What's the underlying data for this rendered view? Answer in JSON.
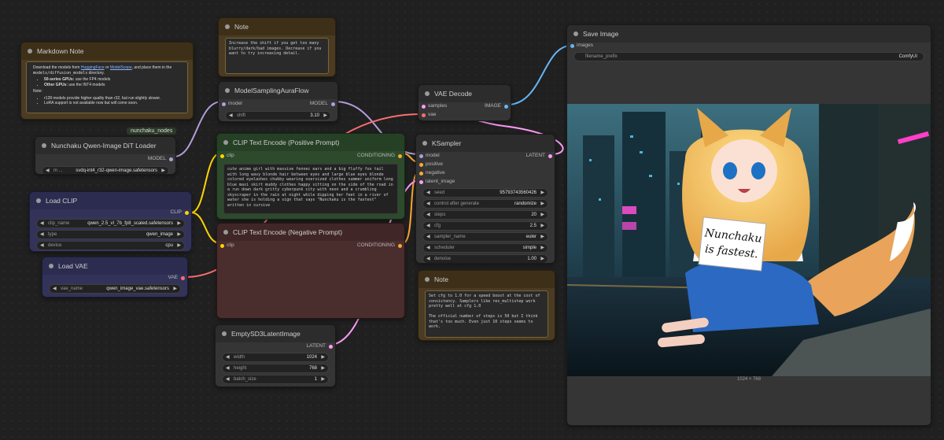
{
  "canvas": {
    "badge": "nunchaku_nodes"
  },
  "note_top": {
    "title": "Note",
    "text": "Increase the shift if you get too many blurry/dark/bad images. Decrease if you want to try increasing detail."
  },
  "markdown_note": {
    "title": "Markdown Note",
    "line1_a": "Download the models from ",
    "link1": "HuggingFace",
    "line1_b": " or ",
    "link2": "ModelScope",
    "line1_c": ", and place them in the ",
    "path": "models/diffusion_models",
    "line1_d": " directory.",
    "b1_bold": "50-series GPUs:",
    "b1_rest": " use the FP4 models",
    "b2_bold": "Other GPUs:",
    "b2_rest": " use the INT4 models",
    "note_label": "Note:",
    "n1": "r128 models provide higher quality than r32, but run slightly slower.",
    "n2": "LoRA support is not available now but will come soon."
  },
  "dit_loader": {
    "title": "Nunchaku Qwen-Image DiT Loader",
    "out_model": "MODEL",
    "w_key": "m ...",
    "w_val": "svdq-int4_r32-qwen-image.safetensors"
  },
  "load_clip": {
    "title": "Load CLIP",
    "out": "CLIP",
    "w1_k": "clip_name",
    "w1_v": "qwen_2.5_vl_7b_fp8_scaled.safetensors",
    "w2_k": "type",
    "w2_v": "qwen_image",
    "w3_k": "device",
    "w3_v": "cpu"
  },
  "load_vae": {
    "title": "Load VAE",
    "out": "VAE",
    "w_k": "vae_name",
    "w_v": "qwen_image_vae.safetensors"
  },
  "model_sampling": {
    "title": "ModelSamplingAuraFlow",
    "in": "model",
    "out": "MODEL",
    "w_k": "shift",
    "w_v": "3.10"
  },
  "clip_pos": {
    "title": "CLIP Text Encode (Positive Prompt)",
    "in": "clip",
    "out": "CONDITIONING",
    "text": "cute anime girl with massive fennec ears and a big fluffy fox tail with long wavy blonde hair between eyes and large blue eyes blonde colored eyelashes chubby wearing oversized clothes summer uniform long blue maxi skirt muddy clothes happy sitting on the side of the road in a run down dark gritty cyberpunk city with neon and a crumbling skyscraper in the rain at night while dipping her feet in a river of water she is holding a sign that says \"Nunchaku is the fastest\" written in cursive"
  },
  "clip_neg": {
    "title": "CLIP Text Encode (Negative Prompt)",
    "in": "clip",
    "out": "CONDITIONING",
    "text": ""
  },
  "empty_latent": {
    "title": "EmptySD3LatentImage",
    "out": "LATENT",
    "w1_k": "width",
    "w1_v": "1024",
    "w2_k": "height",
    "w2_v": "768",
    "w3_k": "batch_size",
    "w3_v": "1"
  },
  "vae_decode": {
    "title": "VAE Decode",
    "in1": "samples",
    "in2": "vae",
    "out": "IMAGE"
  },
  "ksampler": {
    "title": "KSampler",
    "in1": "model",
    "in2": "positive",
    "in3": "negative",
    "in4": "latent_image",
    "out": "LATENT",
    "seed_k": "seed",
    "seed_v": "95793743560426",
    "ctrl_k": "control after generate",
    "ctrl_v": "randomize",
    "steps_k": "steps",
    "steps_v": "20",
    "cfg_k": "cfg",
    "cfg_v": "2.5",
    "sampler_k": "sampler_name",
    "sampler_v": "euler",
    "sched_k": "scheduler",
    "sched_v": "simple",
    "denoise_k": "denoise",
    "denoise_v": "1.00"
  },
  "note_bottom": {
    "title": "Note",
    "text": "Set cfg to 1.0 for a speed boost at the cost of consistency. Samplers like res_multistep work pretty well at cfg 1.0\n\nThe official number of steps is 50 but I think that's too much. Even just 10 steps seems to work."
  },
  "save_image": {
    "title": "Save Image",
    "in": "images",
    "w_k": "filename_prefix",
    "w_v": "ComfyUI",
    "dims": "1024 × 768",
    "sign_line1": "Nunchaku",
    "sign_line2": "is fastest."
  },
  "colors": {
    "model": "#b39ddb",
    "clip": "#ffd500",
    "vae": "#ff6e6e",
    "cond": "#ffa931",
    "latent": "#ff9cf9",
    "image": "#64b5f6"
  }
}
